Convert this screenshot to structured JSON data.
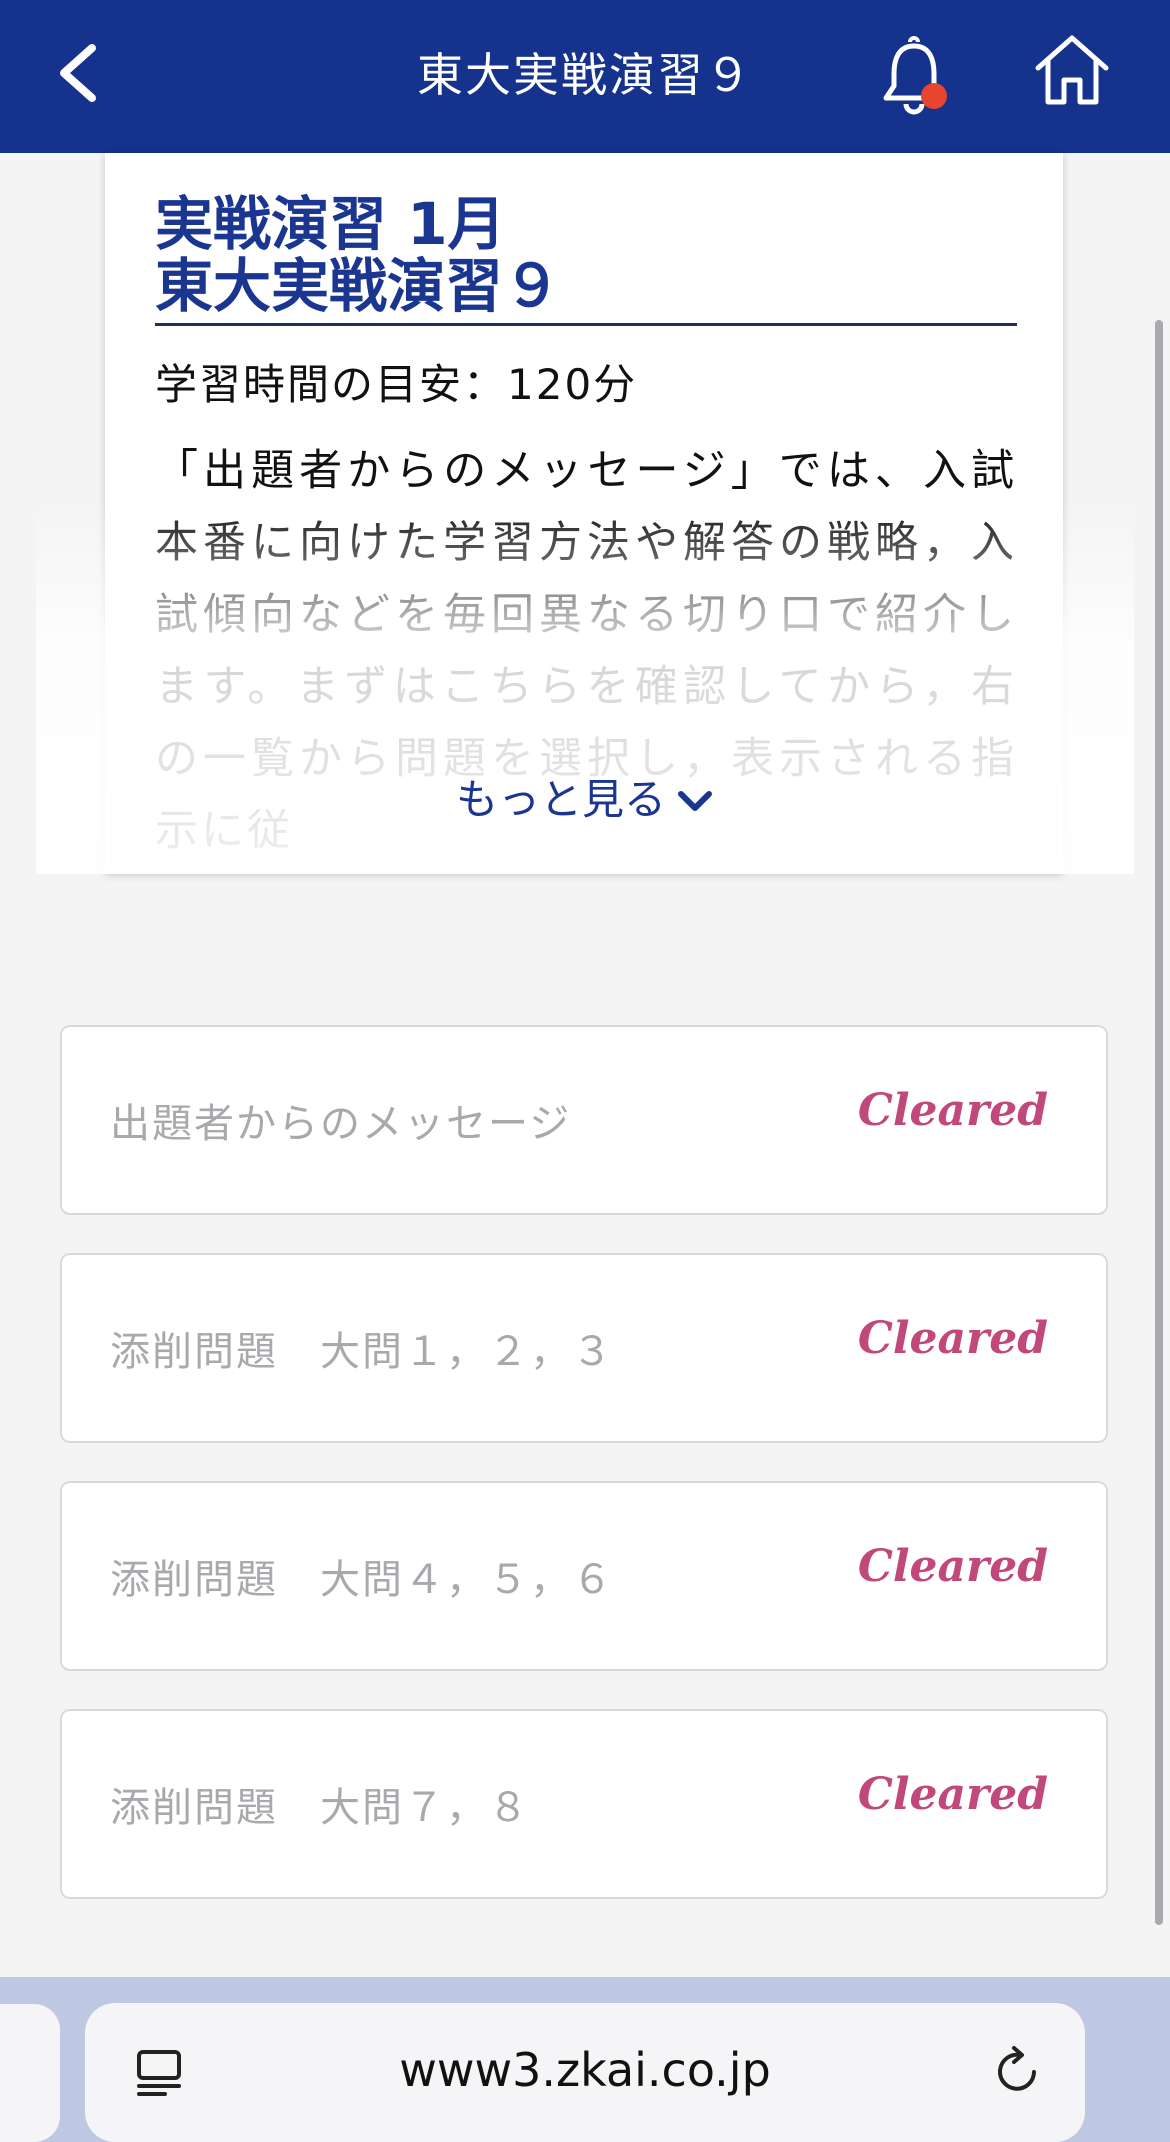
{
  "header": {
    "title": "東大実戦演習９",
    "back_icon": "chevron-left-icon",
    "bell_icon": "bell-icon",
    "home_icon": "home-icon",
    "notification_dot_color": "#e8452e",
    "background_color": "#15328c"
  },
  "intro": {
    "title_line1": "実戦演習 1月",
    "title_line2": "東大実戦演習９",
    "study_time": "学習時間の目安：120分",
    "description": "「出題者からのメッセージ」では、入試本番に向けた学習方法や解答の戦略，入試傾向などを毎回異なる切り口で紹介します。まずはこちらを確認してから，右の一覧から問題を選択し，表示される指示に従",
    "more_label": "もっと見る",
    "more_icon": "chevron-down-icon"
  },
  "items": [
    {
      "label": "出題者からのメッセージ",
      "status": "Cleared"
    },
    {
      "label": "添削問題　大問１，２，３",
      "status": "Cleared"
    },
    {
      "label": "添削問題　大問４，５，６",
      "status": "Cleared"
    },
    {
      "label": "添削問題　大問７，８",
      "status": "Cleared"
    }
  ],
  "colors": {
    "accent": "#1a3690",
    "cleared": "#c1487a"
  },
  "browser": {
    "url": "www3.zkai.co.jp",
    "reader_icon": "reader-mode-icon",
    "reload_icon": "reload-icon"
  }
}
